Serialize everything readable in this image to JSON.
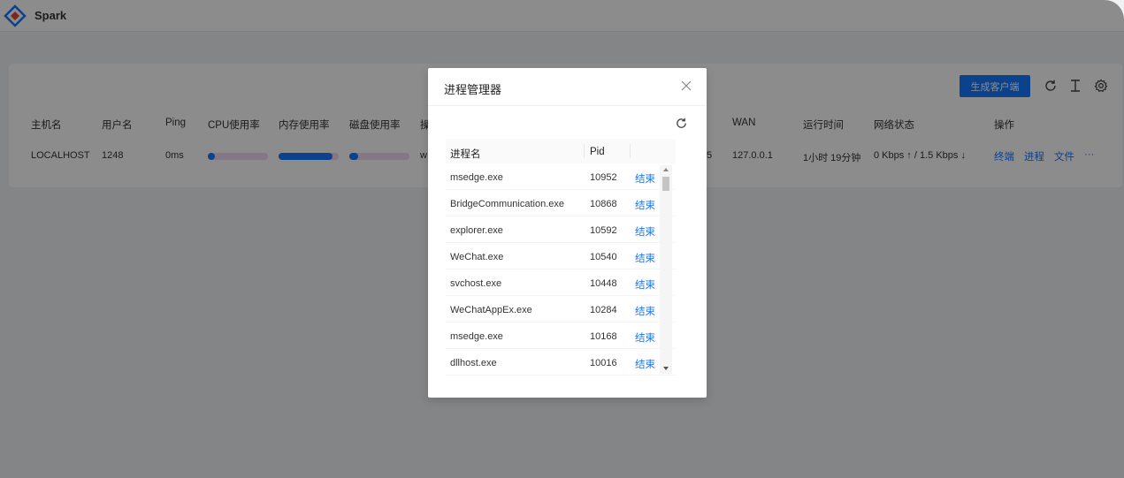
{
  "app": {
    "title": "Spark"
  },
  "toolbar": {
    "generate_label": "生成客户端"
  },
  "table": {
    "headers": [
      "主机名",
      "用户名",
      "Ping",
      "CPU使用率",
      "内存使用率",
      "磁盘使用率",
      "操",
      "WAN",
      "运行时间",
      "网络状态",
      "操作"
    ],
    "row": {
      "hostname": "LOCALHOST",
      "username": "1248",
      "ping": "0ms",
      "os_partial": "w",
      "hidden_partial": "5",
      "wan": "127.0.0.1",
      "uptime": "1小时 19分钟",
      "network": "0 Kbps ↑ / 1.5 Kbps ↓",
      "cpu_usage": 0.05,
      "mem_usage": 0.9,
      "disk_usage": 0.15,
      "actions": [
        "终端",
        "进程",
        "文件",
        "···"
      ]
    }
  },
  "modal": {
    "title": "进程管理器",
    "columns": {
      "name": "进程名",
      "pid": "Pid"
    },
    "rows": [
      {
        "name": "msedge.exe",
        "pid": "10952",
        "action": "结束"
      },
      {
        "name": "BridgeCommunication.exe",
        "pid": "10868",
        "action": "结束"
      },
      {
        "name": "explorer.exe",
        "pid": "10592",
        "action": "结束"
      },
      {
        "name": "WeChat.exe",
        "pid": "10540",
        "action": "结束"
      },
      {
        "name": "svchost.exe",
        "pid": "10448",
        "action": "结束"
      },
      {
        "name": "WeChatAppEx.exe",
        "pid": "10284",
        "action": "结束"
      },
      {
        "name": "msedge.exe",
        "pid": "10168",
        "action": "结束"
      },
      {
        "name": "dllhost.exe",
        "pid": "10016",
        "action": "结束"
      }
    ]
  },
  "colors": {
    "primary": "#1677ff",
    "bar_track": "#f5d9f0",
    "overlay": "rgba(0,0,0,0.45)"
  },
  "icons": [
    "spark-logo-icon",
    "refresh-icon",
    "column-height-icon",
    "settings-icon",
    "close-icon",
    "modal-refresh-icon"
  ]
}
